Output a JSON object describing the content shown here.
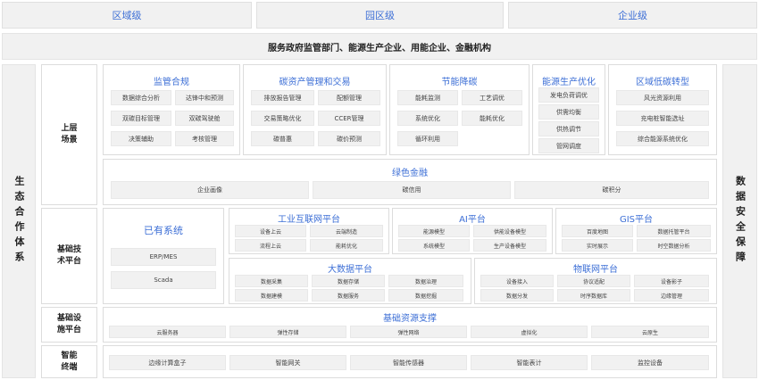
{
  "top_tabs": [
    "区域级",
    "园区级",
    "企业级"
  ],
  "service_banner": "服务政府监管部门、能源生产企业、用能企业、金融机构",
  "left_side": "生态合作体系",
  "right_side": "数据安全保障",
  "row_labels": {
    "upper": [
      "上层",
      "场景"
    ],
    "tech": [
      "基础技",
      "术平台"
    ],
    "infra": [
      "基础设",
      "施平台"
    ],
    "smart": [
      "智能",
      "终端"
    ]
  },
  "scenes": [
    {
      "title": "监管合规",
      "items": [
        "数据综合分析",
        "达锋中和预测",
        "双碳目标管理",
        "双碳驾驶舱",
        "决策辅助",
        "考核管理"
      ]
    },
    {
      "title": "碳资产管理和交易",
      "items": [
        "排放报告管理",
        "配额管理",
        "交易策略优化",
        "CCER管理",
        "碳普惠",
        "碳价预测"
      ]
    },
    {
      "title": "节能降碳",
      "items": [
        "能耗监测",
        "工艺调优",
        "系统优化",
        "能耗优化",
        "循环利用"
      ]
    },
    {
      "title": "能源生产优化",
      "items": [
        "发电负荷调优",
        "供需均衡",
        "供热调节",
        "管网调度"
      ]
    },
    {
      "title": "区域低碳转型",
      "items": [
        "风光资源利用",
        "充电桩智能选址",
        "综合能源系统优化"
      ]
    }
  ],
  "green_finance": {
    "title": "绿色金融",
    "items": [
      "企业画像",
      "碳信用",
      "碳积分"
    ]
  },
  "existing": {
    "title": "已有系统",
    "items": [
      "ERP/MES",
      "Scada"
    ]
  },
  "iiot": {
    "title": "工业互联网平台",
    "items": [
      "设备上云",
      "云端制造",
      "流程上云",
      "能耗优化"
    ]
  },
  "ai": {
    "title": "AI平台",
    "items": [
      "能源模型",
      "供能设备模型",
      "系统模型",
      "生产设备模型"
    ]
  },
  "gis": {
    "title": "GIS平台",
    "items": [
      "百度地图",
      "数据托管平台",
      "实时展示",
      "时空数据分析"
    ]
  },
  "bigdata": {
    "title": "大数据平台",
    "items": [
      "数据采集",
      "数据存储",
      "数据治理",
      "数据建模",
      "数据服务",
      "数据挖掘"
    ]
  },
  "iot": {
    "title": "物联网平台",
    "items": [
      "设备接入",
      "协议适配",
      "设备影子",
      "数据分发",
      "时序数据库",
      "边缘管理"
    ]
  },
  "infra": {
    "title": "基础资源支撑",
    "items": [
      "云服务器",
      "弹性存储",
      "弹性网络",
      "虚拟化",
      "云原生"
    ]
  },
  "terminals": {
    "items": [
      "边缘计算盒子",
      "智能网关",
      "智能传感器",
      "智能表计",
      "监控设备"
    ]
  },
  "colors": {
    "accent": "#3d6fd6",
    "chip_bg": "#f1f1f1",
    "border": "#dcdcdc"
  }
}
